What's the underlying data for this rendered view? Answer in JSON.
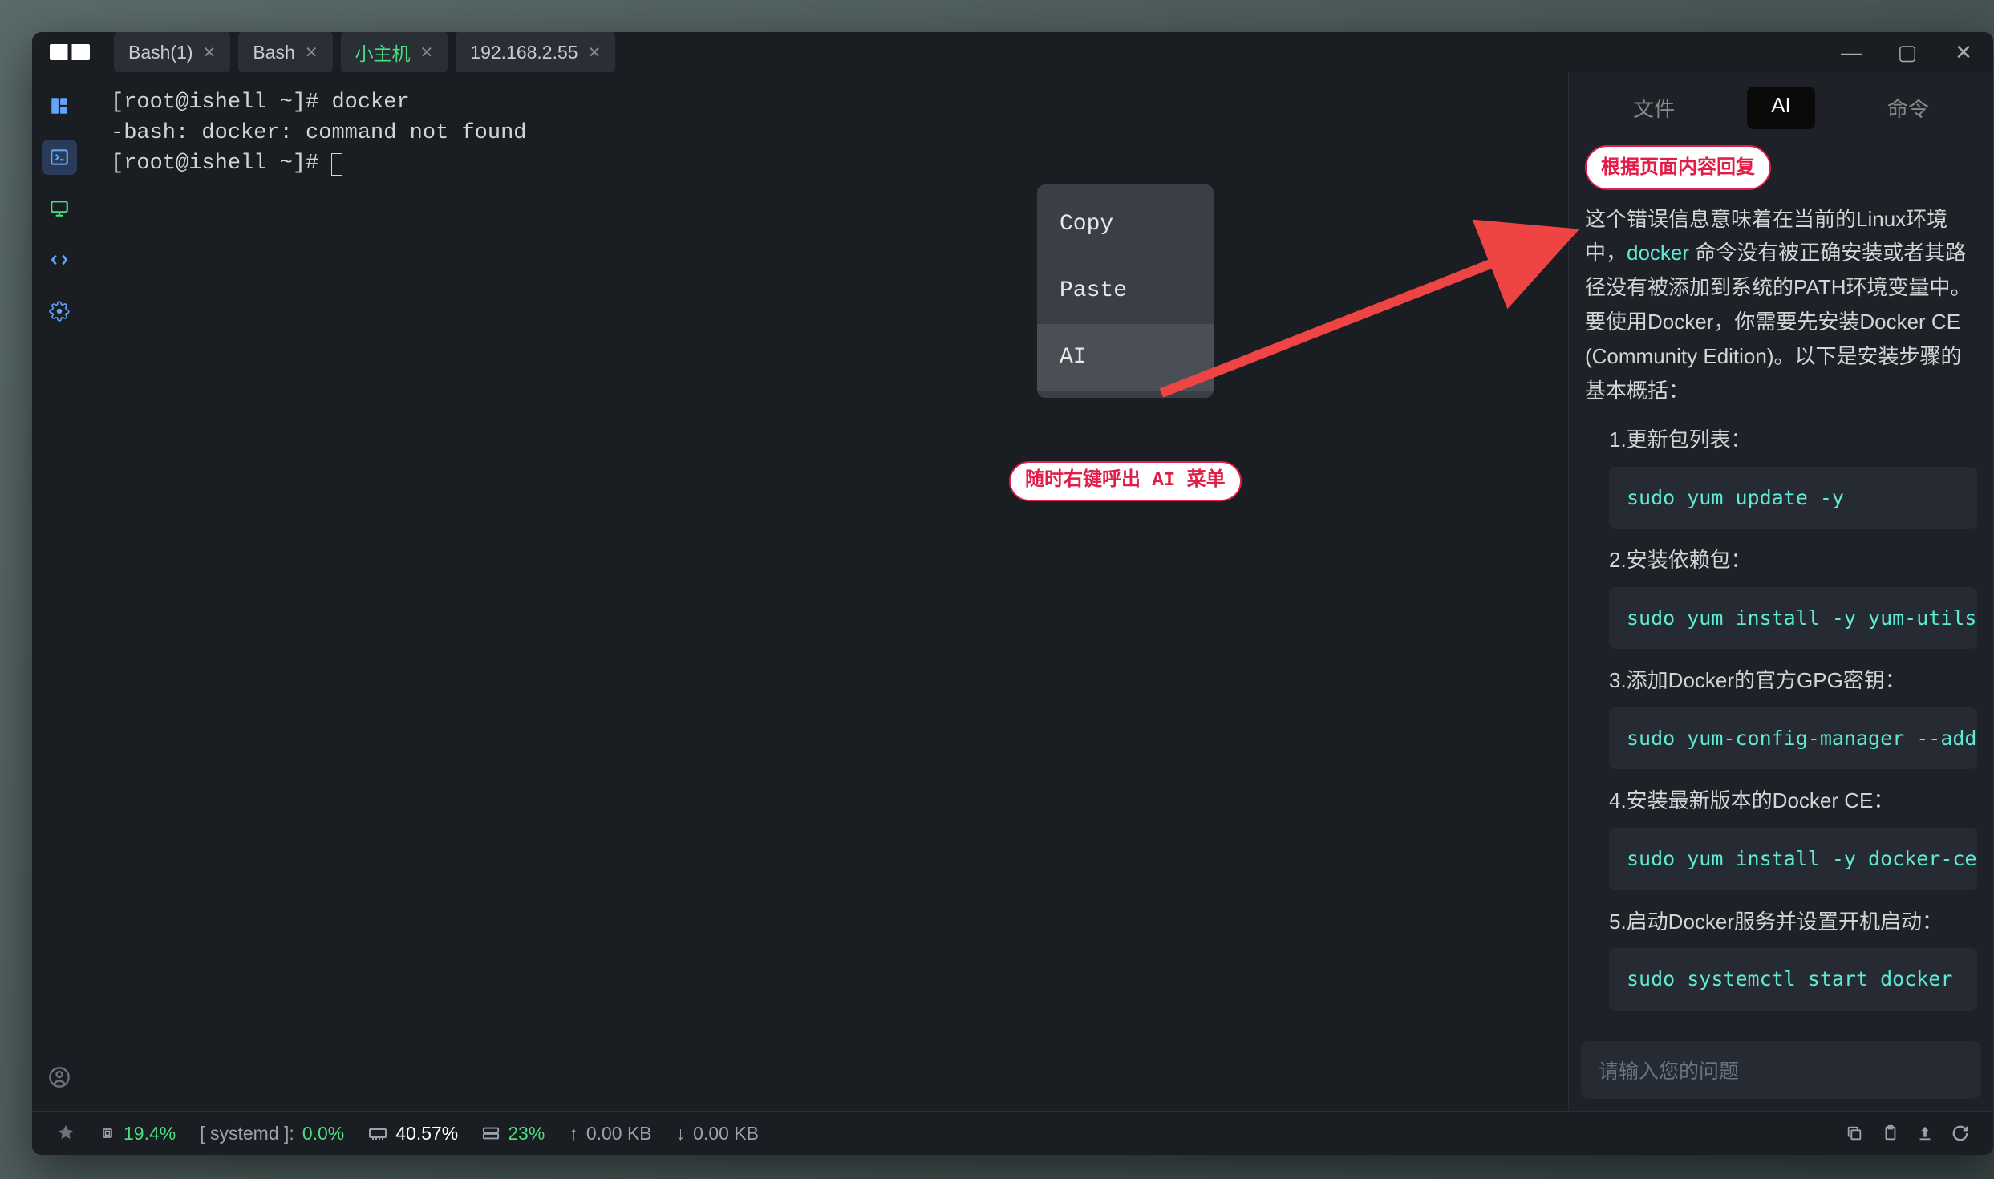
{
  "tabs": [
    {
      "label": "Bash(1)",
      "active": false
    },
    {
      "label": "Bash",
      "active": false
    },
    {
      "label": "小主机",
      "active": true
    },
    {
      "label": "192.168.2.55",
      "active": false
    }
  ],
  "terminal": {
    "line1": "[root@ishell ~]# docker",
    "line2": "-bash: docker: command not found",
    "line3": "[root@ishell ~]# "
  },
  "context_menu": {
    "copy": "Copy",
    "paste": "Paste",
    "ai": "AI"
  },
  "annotations": {
    "menu_hint": "随时右键呼出 AI 菜单",
    "reply_hint": "根据页面内容回复"
  },
  "right_tabs": {
    "file": "文件",
    "ai": "AI",
    "cmd": "命令"
  },
  "ai": {
    "intro_prefix": "这个错误信息意味着在当前的Linux环境中，",
    "docker_word": "docker",
    "intro_suffix": " 命令没有被正确安装或者其路径没有被添加到系统的PATH环境变量中。要使用Docker，你需要先安装Docker CE (Community Edition)。以下是安装步骤的基本概括：",
    "steps": [
      {
        "n": "1.",
        "text": "更新包列表：",
        "code": "sudo yum update -y"
      },
      {
        "n": "2.",
        "text": "安装依赖包：",
        "code": "sudo yum install -y yum-utils devi"
      },
      {
        "n": "3.",
        "text": "添加Docker的官方GPG密钥：",
        "code": "sudo yum-config-manager --add-"
      },
      {
        "n": "4.",
        "text": "安装最新版本的Docker CE：",
        "code": "sudo yum install -y docker-ce doc"
      },
      {
        "n": "5.",
        "text": "启动Docker服务并设置开机启动：",
        "code": "sudo systemctl start docker"
      }
    ],
    "input_placeholder": "请输入您的问题"
  },
  "status": {
    "cpu": "19.4%",
    "proc_label": "[ systemd ]:",
    "proc_val": "0.0%",
    "mem": "40.57%",
    "disk": "23%",
    "up": "0.00 KB",
    "down": "0.00 KB"
  }
}
